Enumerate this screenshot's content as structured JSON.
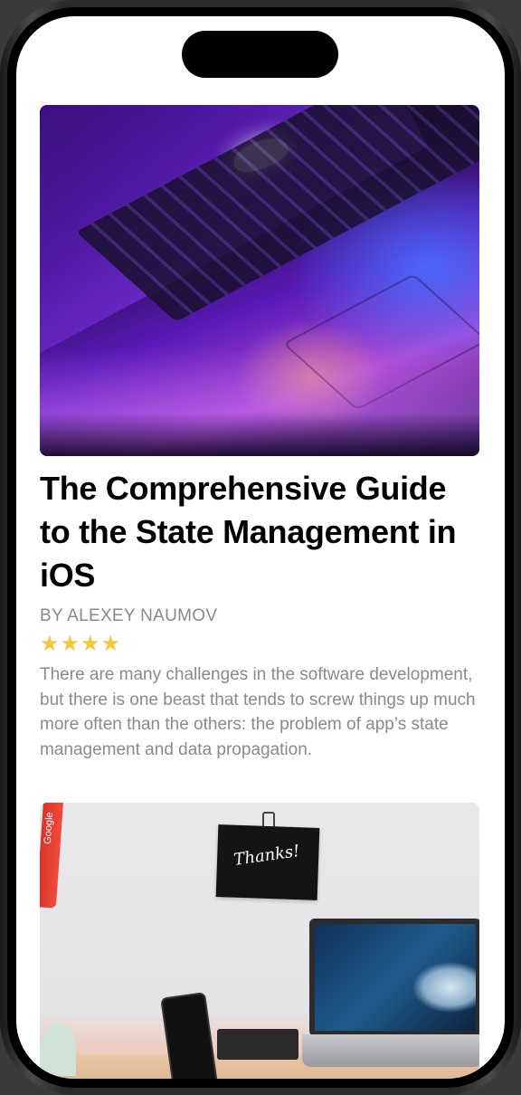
{
  "articles": [
    {
      "image_alt": "laptop-photo",
      "title": "The Comprehensive Guide to the State Management in iOS",
      "author": "BY ALEXEY NAUMOV",
      "rating": 4,
      "stars": "★★★★",
      "excerpt": "There are many challenges in the software development, but there is one beast that tends to screw things up much more often than the others: the problem of app’s state management and data propagation."
    },
    {
      "image_alt": "desk-photo",
      "lanyard_text": "Google",
      "note_text": "Thanks!"
    }
  ],
  "colors": {
    "title": "#000000",
    "secondary_text": "#8a8a8e",
    "star": "#f7c63a",
    "background": "#ffffff"
  }
}
